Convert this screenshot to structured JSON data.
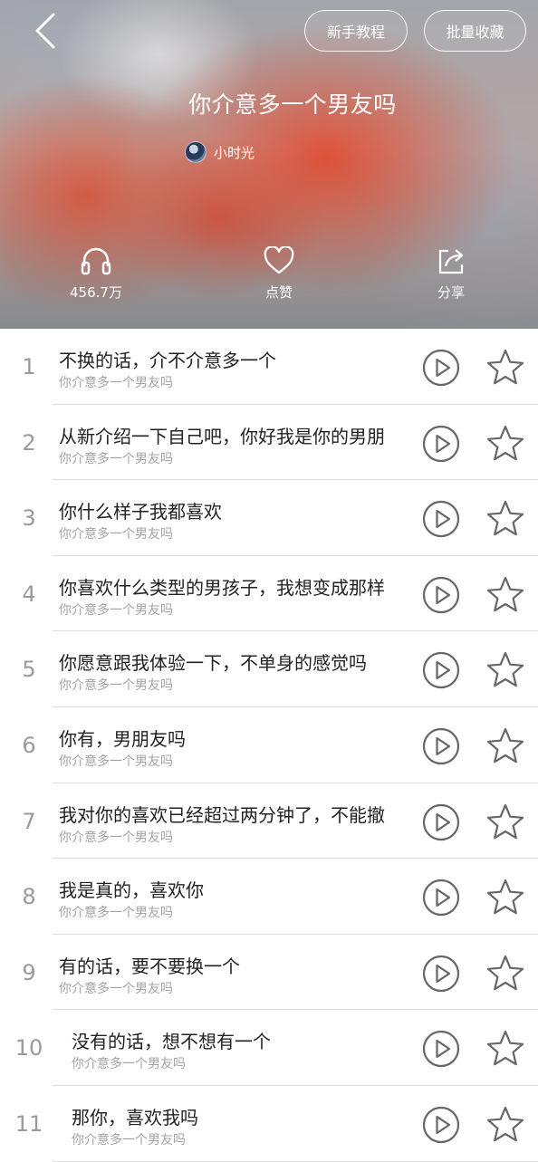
{
  "header": {
    "back_icon": "chevron-left-icon",
    "tutorial_label": "新手教程",
    "batch_collect_label": "批量收藏",
    "album_title": "你介意多一个男友吗",
    "author_name": "小时光"
  },
  "stats": {
    "plays": {
      "icon": "headphones-icon",
      "label": "456.7万"
    },
    "like": {
      "icon": "heart-icon",
      "label": "点赞"
    },
    "share": {
      "icon": "share-icon",
      "label": "分享"
    }
  },
  "tracks": [
    {
      "num": "1",
      "title": "不换的话，介不介意多一个",
      "album": "你介意多一个男友吗"
    },
    {
      "num": "2",
      "title": "从新介绍一下自己吧，你好我是你的男朋",
      "album": "你介意多一个男友吗"
    },
    {
      "num": "3",
      "title": "你什么样子我都喜欢",
      "album": "你介意多一个男友吗"
    },
    {
      "num": "4",
      "title": "你喜欢什么类型的男孩子，我想变成那样",
      "album": "你介意多一个男友吗"
    },
    {
      "num": "5",
      "title": "你愿意跟我体验一下，不单身的感觉吗",
      "album": "你介意多一个男友吗"
    },
    {
      "num": "6",
      "title": "你有，男朋友吗",
      "album": "你介意多一个男友吗"
    },
    {
      "num": "7",
      "title": "我对你的喜欢已经超过两分钟了，不能撤",
      "album": "你介意多一个男友吗"
    },
    {
      "num": "8",
      "title": "我是真的，喜欢你",
      "album": "你介意多一个男友吗"
    },
    {
      "num": "9",
      "title": "有的话，要不要换一个",
      "album": "你介意多一个男友吗"
    },
    {
      "num": "10",
      "title": "没有的话，想不想有一个",
      "album": "你介意多一个男友吗"
    },
    {
      "num": "11",
      "title": "那你，喜欢我吗",
      "album": "你介意多一个男友吗"
    }
  ],
  "row_icons": {
    "play": "play-circle-icon",
    "favorite": "star-icon"
  }
}
